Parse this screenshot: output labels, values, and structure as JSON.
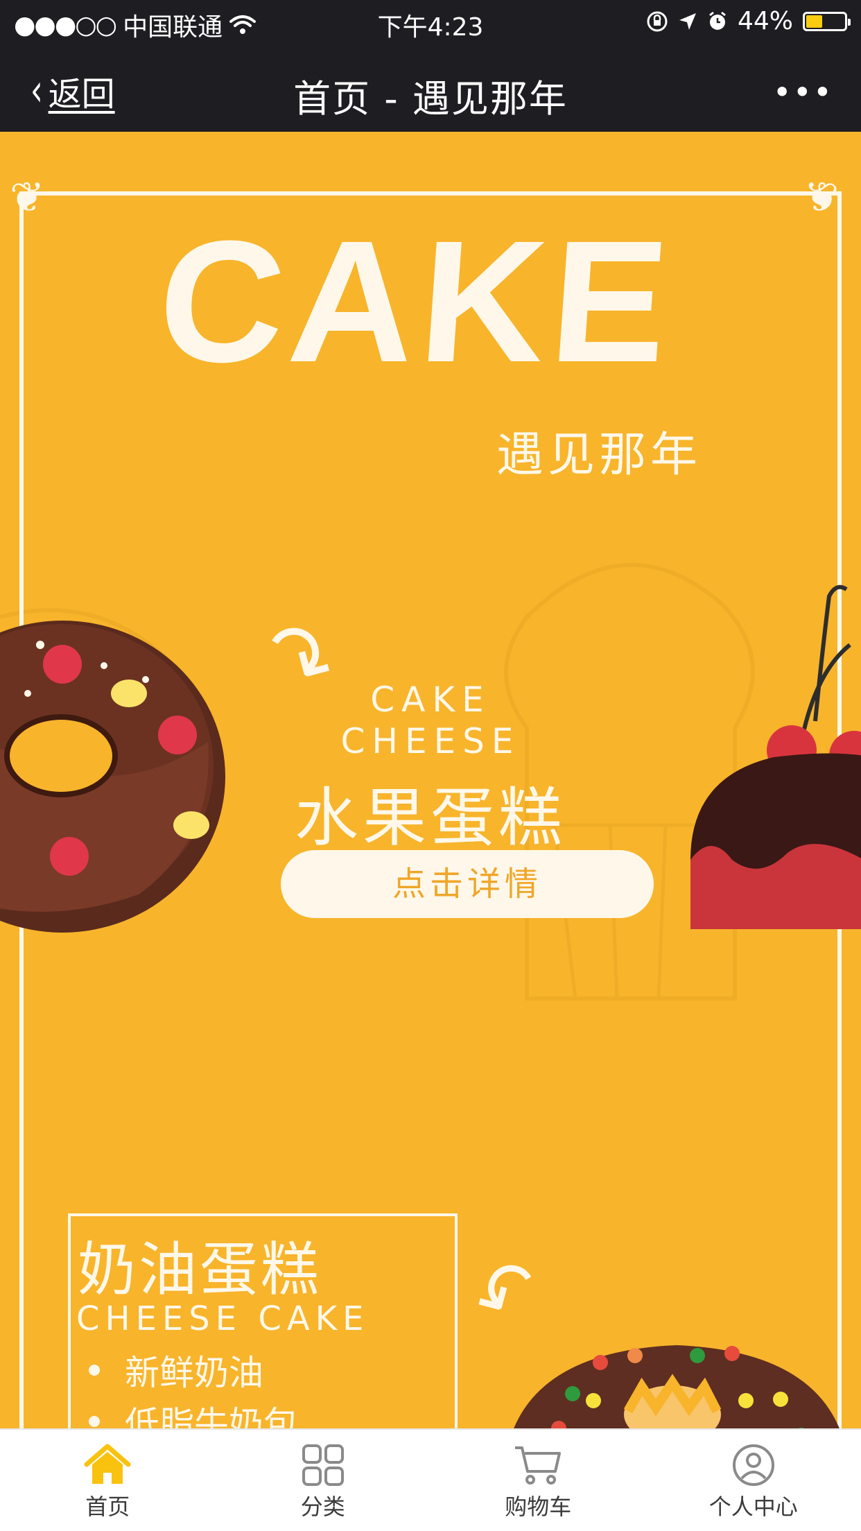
{
  "status_bar": {
    "signal": "●●●○○",
    "carrier": "中国联通",
    "time": "下午4:23",
    "battery_pct": "44%",
    "battery_level": 0.44
  },
  "nav": {
    "back_label": "返回",
    "title": "首页 - 遇见那年",
    "more_label": "•••"
  },
  "banner": {
    "headline": "CAKE",
    "subtitle": "遇见那年",
    "en_line1": "CAKE",
    "en_line2": "CHEESE",
    "cn_title": "水果蛋糕",
    "detail_button": "点击详情"
  },
  "cream_box": {
    "cn_title": "奶油蛋糕",
    "en_title": "CHEESE CAKE",
    "items": [
      "新鲜奶油",
      "低脂牛奶包"
    ]
  },
  "tabs": [
    {
      "label": "首页",
      "icon": "home-icon",
      "active": true
    },
    {
      "label": "分类",
      "icon": "grid-icon",
      "active": false
    },
    {
      "label": "购物车",
      "icon": "cart-icon",
      "active": false
    },
    {
      "label": "个人中心",
      "icon": "user-icon",
      "active": false
    }
  ],
  "colors": {
    "background": "#F8B42B",
    "cream": "#FFF8EA",
    "bar_dark": "#1E1E22",
    "accent_orange": "#F0A629",
    "tab_active": "#F9C20F"
  }
}
